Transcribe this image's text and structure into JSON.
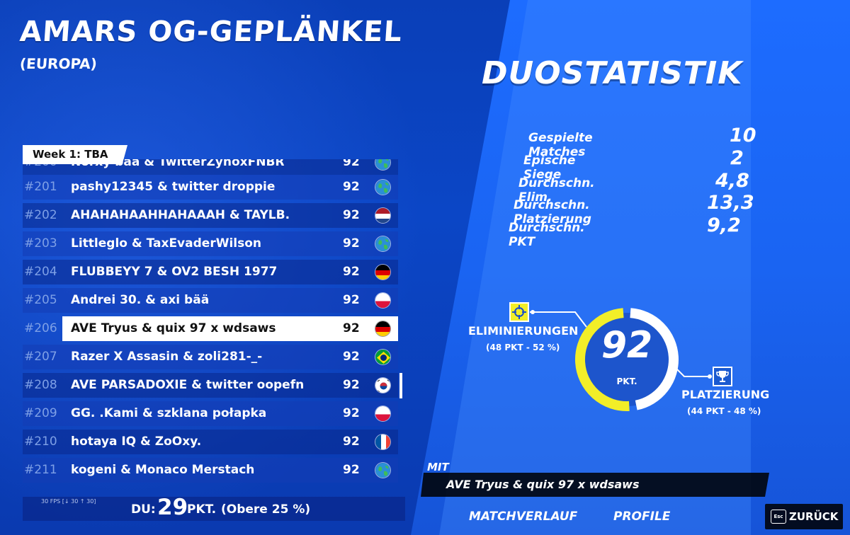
{
  "header": {
    "title": "AMARS OG-GEPLÄNKEL",
    "region": "(EUROPA)"
  },
  "duo": {
    "title": "DUOSTATISTIK",
    "stats": [
      {
        "label": "Gespielte Matches",
        "value": "10"
      },
      {
        "label": "Epische Siege",
        "value": "2"
      },
      {
        "label": "Durchschn. Elim.",
        "value": "4,8"
      },
      {
        "label": "Durchschn. Platzierung",
        "value": "13,3"
      },
      {
        "label": "Durchschn. PKT",
        "value": "9,2"
      }
    ]
  },
  "leaderboard": {
    "week_label": "Week 1: TBA",
    "rows": [
      {
        "rank": "#200",
        "name": "Norxy bää & TwitterZynoxFNBR",
        "points": "92",
        "flag": "globe-icon"
      },
      {
        "rank": "#201",
        "name": "pashy12345 & twitter droppie",
        "points": "92",
        "flag": "globe-icon"
      },
      {
        "rank": "#202",
        "name": "AHAHAHAAHHAHAAAH & TAYLB.",
        "points": "92",
        "flag": "netherlands-flag-icon"
      },
      {
        "rank": "#203",
        "name": "Littleglo & TaxEvaderWilson",
        "points": "92",
        "flag": "globe-icon"
      },
      {
        "rank": "#204",
        "name": "FLUBBEYY 7 & OV2 BESH 1977",
        "points": "92",
        "flag": "germany-flag-icon"
      },
      {
        "rank": "#205",
        "name": "Andrei 30. & axi bää",
        "points": "92",
        "flag": "poland-flag-icon"
      },
      {
        "rank": "#206",
        "name": "AVE Tryus & quix 97 x wdsaws",
        "points": "92",
        "flag": "germany-flag-icon",
        "selected": true
      },
      {
        "rank": "#207",
        "name": "Razer X Assasin & zoli281-_-",
        "points": "92",
        "flag": "brazil-flag-icon"
      },
      {
        "rank": "#208",
        "name": "AVE PARSADOXIE & twitter oopefn",
        "points": "92",
        "flag": "south-korea-flag-icon"
      },
      {
        "rank": "#209",
        "name": "GG. .Kami & szklana połapka",
        "points": "92",
        "flag": "poland-flag-icon"
      },
      {
        "rank": "#210",
        "name": "hotaya IQ & ZoOxy.",
        "points": "92",
        "flag": "france-flag-icon"
      },
      {
        "rank": "#211",
        "name": "kogeni & Monaco Merstach",
        "points": "92",
        "flag": "globe-icon"
      }
    ]
  },
  "footer": {
    "fps": "30 FPS [↓ 30 ↑ 30]",
    "du_label": "DU:",
    "du_points": "29",
    "du_unit": "PKT.",
    "du_rank": "(Obere 25 %)"
  },
  "points_breakdown": {
    "total": "92",
    "unit": "PKT.",
    "elim_label": "ELIMINIERUNGEN",
    "elim_sub": "(48 PKT - 52 %)",
    "elim_fraction": 0.52,
    "place_label": "PLATZIERUNG",
    "place_sub": "(44 PKT - 48 %)",
    "place_fraction": 0.48,
    "colors": {
      "elim": "#f2ee28",
      "place": "#ffffff"
    }
  },
  "teammate": {
    "label": "MIT",
    "name": "AVE Tryus & quix 97 x wdsaws"
  },
  "nav": {
    "match_history": "MATCHVERLAUF",
    "profiles": "PROFILE",
    "esc": "Esc",
    "back": "ZURÜCK"
  }
}
